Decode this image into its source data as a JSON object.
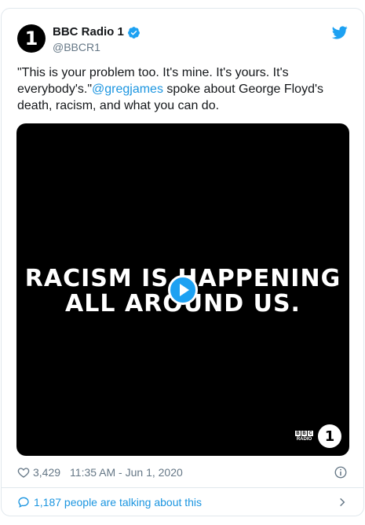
{
  "account": {
    "display_name": "BBC Radio 1",
    "handle": "@BBCR1",
    "avatar_text": "1"
  },
  "tweet": {
    "text_before": "\"This is your problem too. It's mine. It's yours. It's everybody's.\"",
    "mention": "@gregjames",
    "text_after": " spoke about George Floyd's death, racism, and what you can do."
  },
  "media": {
    "line1": "RACISM IS HAPPENING",
    "line2": "ALL AROUND US.",
    "bbc_letters": [
      "B",
      "B",
      "C"
    ],
    "bbc_radio": "RADIO",
    "r1_text": "1"
  },
  "meta": {
    "likes": "3,429",
    "timestamp": "11:35 AM - Jun 1, 2020"
  },
  "footer": {
    "talking": "1,187 people are talking about this"
  },
  "colors": {
    "accent": "#1da1f2",
    "link": "#1b95e0",
    "muted": "#657786"
  },
  "icons": [
    "verified-badge-icon",
    "twitter-bird-icon",
    "play-icon",
    "heart-icon",
    "info-icon",
    "speech-bubble-icon",
    "chevron-right-icon"
  ]
}
